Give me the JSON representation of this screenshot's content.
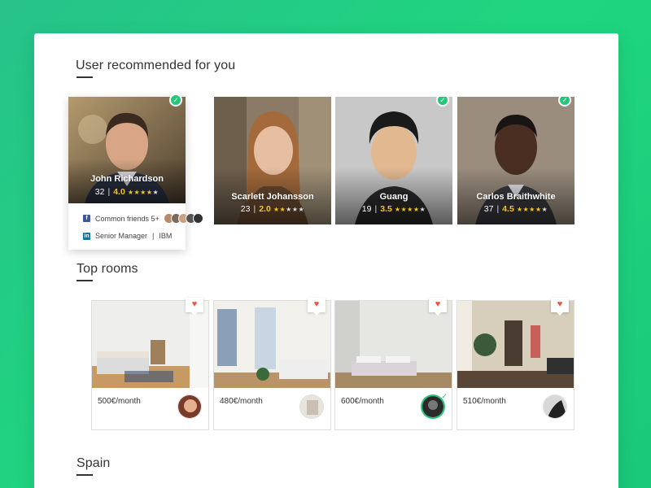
{
  "sections": {
    "users_title": "User recommended for you",
    "rooms_title": "Top rooms",
    "spain_title": "Spain"
  },
  "users": [
    {
      "name": "John Richardson",
      "age": "32",
      "rating": "4.0",
      "stars": 4,
      "verified": true,
      "common_friends_label": "Common friends 5+",
      "job_title": "Senior Manager",
      "company": "IBM",
      "facebook_icon": "facebook-icon",
      "linkedin_icon": "linkedin-icon"
    },
    {
      "name": "Scarlett Johansson",
      "age": "23",
      "rating": "2.0",
      "stars": 2,
      "verified": false
    },
    {
      "name": "Guang",
      "age": "19",
      "rating": "3.5",
      "stars": 3.5,
      "verified": true
    },
    {
      "name": "Carlos Braithwhite",
      "age": "37",
      "rating": "4.5",
      "stars": 4.5,
      "verified": true
    }
  ],
  "rooms": [
    {
      "price": "500€/month",
      "favorite_icon": "heart-icon",
      "owner_verified": false
    },
    {
      "price": "480€/month",
      "favorite_icon": "heart-icon",
      "owner_verified": false
    },
    {
      "price": "600€/month",
      "favorite_icon": "heart-icon",
      "owner_verified": true
    },
    {
      "price": "510€/month",
      "favorite_icon": "heart-icon",
      "owner_verified": false
    }
  ],
  "colors": {
    "background_accent": "#1fd67f",
    "verified_green": "#22c77a",
    "rating_yellow": "#f5c518",
    "heart_red": "#f0543f",
    "facebook_blue": "#3b5998",
    "linkedin_blue": "#0e76a8"
  }
}
